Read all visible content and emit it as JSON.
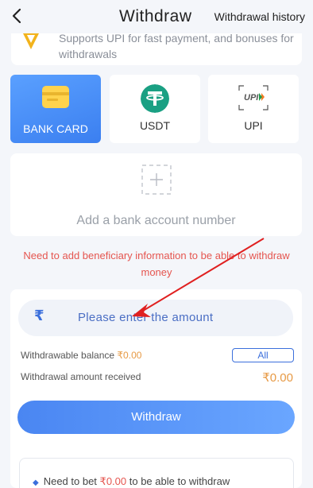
{
  "header": {
    "back_icon": "chevron-left-icon",
    "title": "Withdraw",
    "history_link": "Withdrawal history"
  },
  "upi_notice": {
    "text": "Supports UPI for fast payment, and bonuses for withdrawals"
  },
  "methods": [
    {
      "label": "BANK CARD",
      "icon": "bank-card-icon",
      "selected": true
    },
    {
      "label": "USDT",
      "icon": "tether-icon",
      "selected": false
    },
    {
      "label": "UPI",
      "icon": "upi-logo-icon",
      "selected": false
    }
  ],
  "add_account": {
    "label": "Add a bank account number"
  },
  "warning": "Need to add beneficiary information to be able to withdraw money",
  "amount": {
    "currency_symbol": "₹",
    "placeholder": "Please enter the amount"
  },
  "balance": {
    "withdrawable_label": "Withdrawable balance",
    "withdrawable_value": "₹0.00",
    "all_button": "All",
    "received_label": "Withdrawal amount received",
    "received_value": "₹0.00"
  },
  "withdraw_button": "Withdraw",
  "note": {
    "prefix": "Need to bet",
    "value": "₹0.00",
    "suffix": "to be able to withdraw"
  },
  "colors": {
    "accent": "#3b7ff0",
    "warning": "#e5554f",
    "amount": "#e79a45",
    "background": "#f4f6fa"
  }
}
